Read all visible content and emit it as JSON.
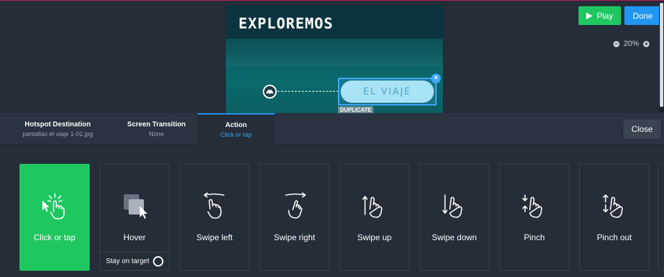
{
  "canvas": {
    "screen_title": "EXPLOREMOS",
    "hotspot_text": "EL VIAJE",
    "duplicate_label": "DUPLICATE",
    "play_label": "Play",
    "done_label": "Done",
    "zoom_level": "20%"
  },
  "tabs": [
    {
      "title": "Hotspot Destination",
      "sub": "pantallas el viaje 1-01.jpg",
      "active": false
    },
    {
      "title": "Screen Transition",
      "sub": "None",
      "active": false
    },
    {
      "title": "Action",
      "sub": "Click or tap",
      "active": true
    }
  ],
  "close_label": "Close",
  "actions": [
    {
      "label": "Click or tap",
      "icon": "tap-gesture-icon",
      "selected": true
    },
    {
      "label": "Hover",
      "icon": "hover-cursor-icon",
      "selected": false,
      "option": "Stay on target"
    },
    {
      "label": "Swipe left",
      "icon": "swipe-left-icon",
      "selected": false
    },
    {
      "label": "Swipe right",
      "icon": "swipe-right-icon",
      "selected": false
    },
    {
      "label": "Swipe up",
      "icon": "swipe-up-icon",
      "selected": false
    },
    {
      "label": "Swipe down",
      "icon": "swipe-down-icon",
      "selected": false
    },
    {
      "label": "Pinch",
      "icon": "pinch-icon",
      "selected": false
    },
    {
      "label": "Pinch out",
      "icon": "pinch-out-icon",
      "selected": false
    }
  ],
  "colors": {
    "background": "#252d39",
    "selected": "#1fc761",
    "accent": "#2196f3"
  }
}
